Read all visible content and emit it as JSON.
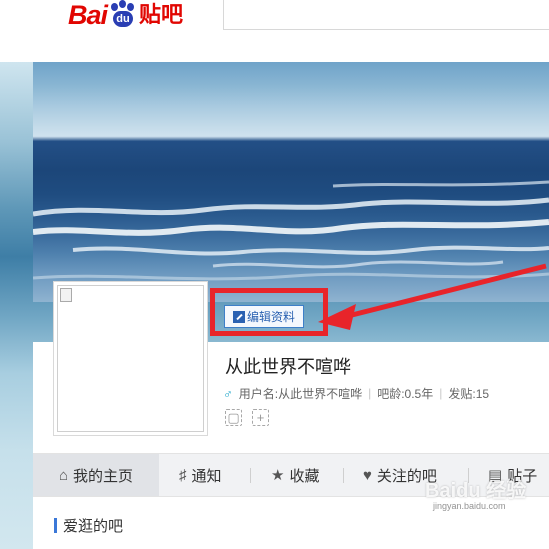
{
  "header": {
    "logo_bai": "Bai",
    "logo_du": "du",
    "logo_tieba": "贴吧"
  },
  "profile": {
    "edit_button": "编辑资料",
    "display_name": "从此世界不喧哗",
    "username_label": "用户名:从此世界不喧哗",
    "bar_age": "吧龄:0.5年",
    "posts": "发贴:15",
    "gender_icon": "male-icon"
  },
  "tabs": [
    {
      "label": "我的主页",
      "icon": "home-icon"
    },
    {
      "label": "通知",
      "icon": "bell-icon"
    },
    {
      "label": "收藏",
      "icon": "star-icon"
    },
    {
      "label": "关注的吧",
      "icon": "heart-icon"
    },
    {
      "label": "贴子",
      "icon": "document-icon"
    }
  ],
  "section": {
    "title": "爱逛的吧"
  },
  "watermark": {
    "main": "Baidu 经验",
    "sub": "jingyan.baidu.com"
  },
  "colors": {
    "highlight": "#e8242a",
    "brand_red": "#e10602",
    "brand_blue": "#2a3eb3",
    "link_blue": "#2b62b2"
  }
}
